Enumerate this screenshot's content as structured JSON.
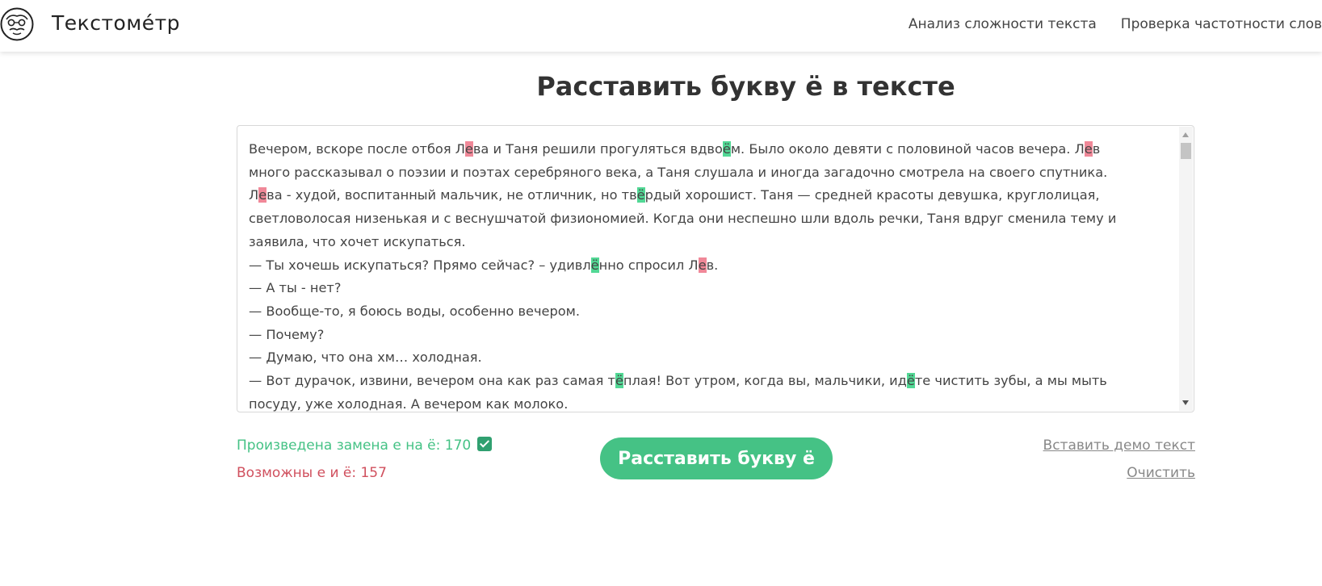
{
  "header": {
    "brand": "Текстоме́тр",
    "logo_icon": "face-icon",
    "nav": [
      {
        "label": "Анализ сложности текста"
      },
      {
        "label": "Проверка частотности слов"
      }
    ]
  },
  "page": {
    "title": "Расставить букву ё в тексте"
  },
  "editor": {
    "lines": [
      [
        {
          "t": "Вечером, вскоре после отбоя Л"
        },
        {
          "t": "е",
          "h": "red"
        },
        {
          "t": "ва и Таня решили прогуляться вдво"
        },
        {
          "t": "ё",
          "h": "green"
        },
        {
          "t": "м. Было около девяти с половиной часов вечера. Л"
        },
        {
          "t": "е",
          "h": "red"
        },
        {
          "t": "в"
        }
      ],
      [
        {
          "t": "много рассказывал о поэзии и поэтах серебряного века, а Таня слушала и иногда загадочно смотрела на своего спутника."
        }
      ],
      [
        {
          "t": "Л"
        },
        {
          "t": "е",
          "h": "red"
        },
        {
          "t": "ва - худой, воспитанный мальчик, не отличник, но тв"
        },
        {
          "t": "ё",
          "h": "green"
        },
        {
          "t": "рдый хорошист. Таня — средней красоты девушка, круглолицая,"
        }
      ],
      [
        {
          "t": "светловолосая низенькая и с веснушчатой физиономией. Когда они неспешно шли вдоль речки, Таня вдруг сменила тему и"
        }
      ],
      [
        {
          "t": "заявила, что хочет искупаться."
        }
      ],
      [
        {
          "t": "— Ты хочешь искупаться? Прямо сейчас? – удивл"
        },
        {
          "t": "ё",
          "h": "green"
        },
        {
          "t": "нно спросил Л"
        },
        {
          "t": "е",
          "h": "red"
        },
        {
          "t": "в."
        }
      ],
      [
        {
          "t": "— А ты - нет?"
        }
      ],
      [
        {
          "t": "— Вообще-то, я боюсь воды, особенно вечером."
        }
      ],
      [
        {
          "t": "— Почему?"
        }
      ],
      [
        {
          "t": "— Думаю, что она хм… холодная."
        }
      ],
      [
        {
          "t": "— Вот дурачок, извини, вечером она как раз самая т"
        },
        {
          "t": "ё",
          "h": "green"
        },
        {
          "t": "плая! Вот утром, когда вы, мальчики, ид"
        },
        {
          "t": "ё",
          "h": "green"
        },
        {
          "t": "те чистить зубы, а мы мыть"
        }
      ],
      [
        {
          "t": "посуду, уже холодная. А вечером как молоко."
        }
      ]
    ]
  },
  "stats": {
    "replaced": "Произведена замена е на ё: 170",
    "possible": "Возможны е и ё: 157"
  },
  "actions": {
    "main_button": "Расставить букву ё",
    "demo_link": "Вставить демо текст",
    "clear_link": "Очистить"
  },
  "colors": {
    "accent": "#45c285",
    "highlight_red": "#f08898",
    "highlight_green": "#52d895",
    "stat_red": "#d0505e"
  }
}
